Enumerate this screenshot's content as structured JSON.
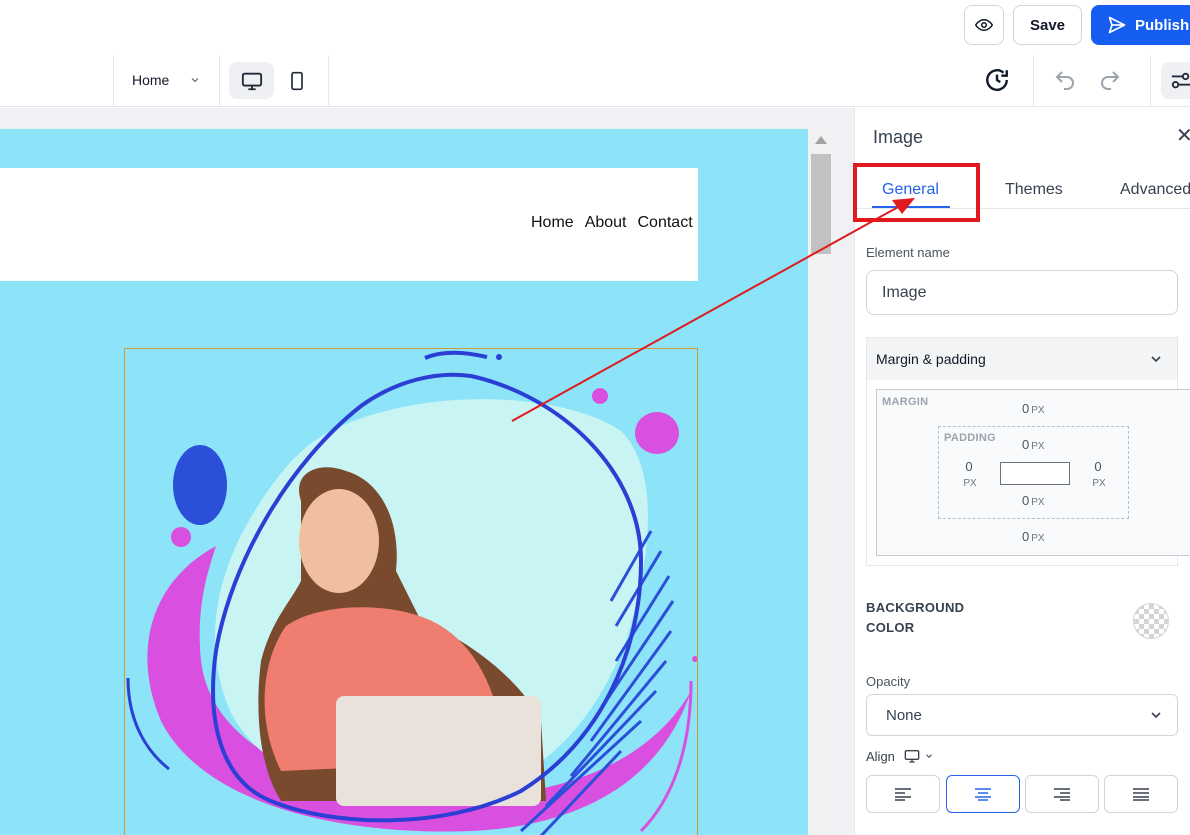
{
  "topbar": {
    "preview_icon": "eye-icon",
    "save_label": "Save",
    "publish_label": "Publish",
    "publish_icon": "send-icon",
    "publish_color": "#155eef"
  },
  "toolbar": {
    "page_select": "Home",
    "device_desktop_icon": "desktop-icon",
    "device_mobile_icon": "mobile-icon",
    "history_icon": "history-icon",
    "undo_icon": "undo-icon",
    "redo_icon": "redo-icon",
    "settings_icon": "settings-sliders-icon"
  },
  "canvas": {
    "background_color": "#8de3f7",
    "nav": [
      "Home",
      "About",
      "Contact"
    ]
  },
  "panel": {
    "title": "Image",
    "tabs": [
      {
        "label": "General",
        "active": true
      },
      {
        "label": "Themes",
        "active": false
      },
      {
        "label": "Advanced",
        "active": false
      }
    ],
    "element_name_label": "Element name",
    "element_name_value": "Image",
    "margin_padding": {
      "label": "Margin & padding",
      "margin_caption": "MARGIN",
      "padding_caption": "PADDING",
      "unit": "PX",
      "margin_top": "0",
      "margin_bottom": "0",
      "padding_top": "0",
      "padding_bottom": "0",
      "padding_left": "0",
      "padding_right": "0"
    },
    "background_color_label_1": "BACKGROUND",
    "background_color_label_2": "COLOR",
    "opacity_label": "Opacity",
    "opacity_value": "None",
    "align_label": "Align",
    "align_options": [
      "left",
      "center",
      "right",
      "justify"
    ],
    "align_selected": "center"
  },
  "annotation": {
    "highlight_color": "#e0191e"
  }
}
